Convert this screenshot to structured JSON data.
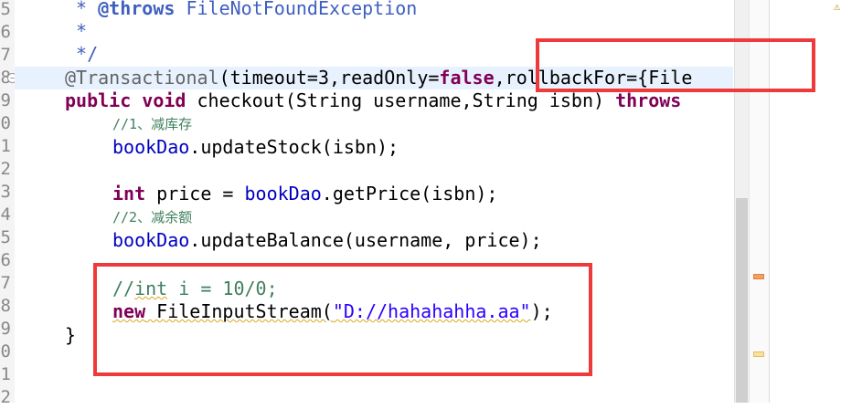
{
  "gutter": {
    "line_numbers": [
      "5",
      "6",
      "7",
      "8",
      "9",
      "0",
      "1",
      "2",
      "3",
      "4",
      "5",
      "6",
      "7",
      "8",
      "9",
      "0",
      "1",
      "2"
    ]
  },
  "code": {
    "l1_prefix": " * ",
    "l1_tag": "@throws",
    "l1_text": " FileNotFoundException",
    "l2": " *",
    "l3": " */",
    "l4_ann": "@Transactional",
    "l4_args": "(timeout=3,readOnly=",
    "l4_false": "false",
    "l4_rest": ",rollbackFor={File",
    "l5_public": "public",
    "l5_void": "void",
    "l5_sig": " checkout(String username,String isbn) ",
    "l5_throws": "throws",
    "l6_comment": "//1、减库存",
    "l7_field": "bookDao",
    "l7_rest": ".updateStock(isbn);",
    "l9_int": "int",
    "l9_mid": " price = ",
    "l9_field": "bookDao",
    "l9_rest": ".getPrice(isbn);",
    "l10_comment": "//2、减余额",
    "l11_field": "bookDao",
    "l11_rest": ".updateBalance(username, price);",
    "l13_comment_a": "//",
    "l13_comment_b": "int",
    "l13_comment_c": " i = 10/0;",
    "l14_new": "new",
    "l14_class": " FileInputStream(",
    "l14_str": "\"D://hahahahha.aa\"",
    "l14_end": ");",
    "l15": "}"
  },
  "colors": {
    "keyword": "#7f0055",
    "comment": "#3f7f5f",
    "javadoc": "#3f5fbf",
    "string": "#2a00ff",
    "field": "#0000c0",
    "highlight_box": "#ee3a3a"
  },
  "icons": {
    "fold": "collapse-icon",
    "warning": "warning-icon"
  }
}
